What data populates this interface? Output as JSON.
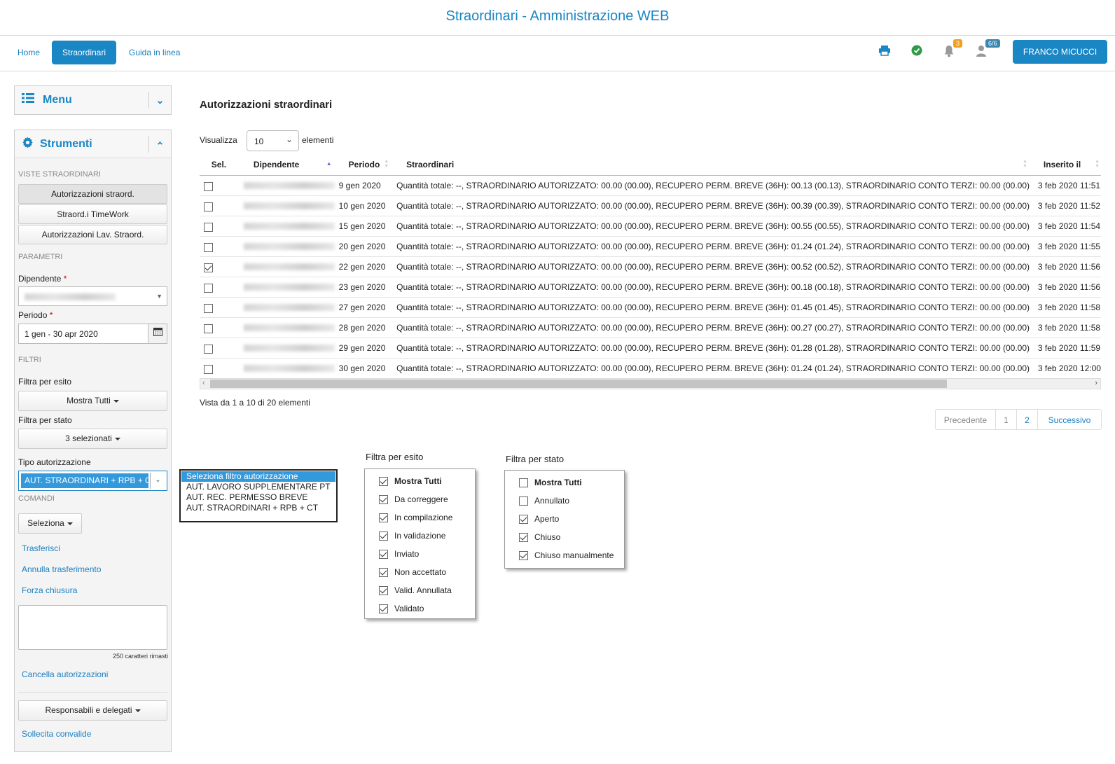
{
  "app_title": "Straordinari - Amministrazione WEB",
  "nav": {
    "home": "Home",
    "straordinari": "Straordinari",
    "guida": "Guida in linea"
  },
  "top_icons": {
    "notifications_count": "3",
    "users_count": "6/6",
    "user_name": "FRANCO MICUCCI"
  },
  "menu_panel": {
    "title": "Menu"
  },
  "tools_panel": {
    "title": "Strumenti",
    "views_title": "VISTE STRAORDINARI",
    "views": [
      "Autorizzazioni straord.",
      "Straord.i TimeWork",
      "Autorizzazioni Lav. Straord."
    ],
    "params_title": "PARAMETRI",
    "employee_label": "Dipendente",
    "required_mark": "*",
    "employee_value": "MICUCCI FRANCESCO",
    "period_label": "Periodo",
    "period_value": "1 gen - 30 apr 2020",
    "filters_title": "FILTRI",
    "esito_label": "Filtra per esito",
    "esito_value": "Mostra Tutti",
    "stato_label": "Filtra per stato",
    "stato_value": "3 selezionati",
    "tipo_label": "Tipo autorizzazione",
    "tipo_value": "AUT. STRAORDINARI + RPB + CT",
    "commands_title": "COMANDI",
    "seleziona_label": "Seleziona",
    "trasferisci": "Trasferisci",
    "annulla_trasferimento": "Annulla trasferimento",
    "forza_chiusura": "Forza chiusura",
    "chars_left": "250 caratteri rimasti",
    "cancella_autorizzazioni": "Cancella autorizzazioni",
    "responsabili_label": "Responsabili e delegati",
    "sollecita_convalide": "Sollecita convalide"
  },
  "main": {
    "title": "Autorizzazioni straordinari",
    "show_label": "Visualizza",
    "show_value": "10",
    "elements_label": "elementi",
    "columns": [
      "Sel.",
      "Dipendente",
      "Periodo",
      "Straordinari",
      "Inserito il"
    ],
    "rows": [
      {
        "checked": false,
        "employee": "MICUCCI FRANCESCO",
        "period": "9 gen 2020",
        "detail": "Quantità totale: --, STRAORDINARIO AUTORIZZATO: 00.00 (00.00), RECUPERO PERM. BREVE (36H): 00.13 (00.13), STRAORDINARIO CONTO TERZI: 00.00 (00.00)",
        "inserted": "3 feb 2020 11:51"
      },
      {
        "checked": false,
        "employee": "MICUCCI FRANCESCO",
        "period": "10 gen 2020",
        "detail": "Quantità totale: --, STRAORDINARIO AUTORIZZATO: 00.00 (00.00), RECUPERO PERM. BREVE (36H): 00.39 (00.39), STRAORDINARIO CONTO TERZI: 00.00 (00.00)",
        "inserted": "3 feb 2020 11:52"
      },
      {
        "checked": false,
        "employee": "MICUCCI FRANCESCO",
        "period": "15 gen 2020",
        "detail": "Quantità totale: --, STRAORDINARIO AUTORIZZATO: 00.00 (00.00), RECUPERO PERM. BREVE (36H): 00.55 (00.55), STRAORDINARIO CONTO TERZI: 00.00 (00.00)",
        "inserted": "3 feb 2020 11:54"
      },
      {
        "checked": false,
        "employee": "MICUCCI FRANCESCO",
        "period": "20 gen 2020",
        "detail": "Quantità totale: --, STRAORDINARIO AUTORIZZATO: 00.00 (00.00), RECUPERO PERM. BREVE (36H): 01.24 (01.24), STRAORDINARIO CONTO TERZI: 00.00 (00.00)",
        "inserted": "3 feb 2020 11:55"
      },
      {
        "checked": true,
        "employee": "MICUCCI FRANCESCO",
        "period": "22 gen 2020",
        "detail": "Quantità totale: --, STRAORDINARIO AUTORIZZATO: 00.00 (00.00), RECUPERO PERM. BREVE (36H): 00.52 (00.52), STRAORDINARIO CONTO TERZI: 00.00 (00.00)",
        "inserted": "3 feb 2020 11:56"
      },
      {
        "checked": false,
        "employee": "MICUCCI FRANCESCO",
        "period": "23 gen 2020",
        "detail": "Quantità totale: --, STRAORDINARIO AUTORIZZATO: 00.00 (00.00), RECUPERO PERM. BREVE (36H): 00.18 (00.18), STRAORDINARIO CONTO TERZI: 00.00 (00.00)",
        "inserted": "3 feb 2020 11:56"
      },
      {
        "checked": false,
        "employee": "MICUCCI FRANCESCO",
        "period": "27 gen 2020",
        "detail": "Quantità totale: --, STRAORDINARIO AUTORIZZATO: 00.00 (00.00), RECUPERO PERM. BREVE (36H): 01.45 (01.45), STRAORDINARIO CONTO TERZI: 00.00 (00.00)",
        "inserted": "3 feb 2020 11:58"
      },
      {
        "checked": false,
        "employee": "MICUCCI FRANCESCO",
        "period": "28 gen 2020",
        "detail": "Quantità totale: --, STRAORDINARIO AUTORIZZATO: 00.00 (00.00), RECUPERO PERM. BREVE (36H): 00.27 (00.27), STRAORDINARIO CONTO TERZI: 00.00 (00.00)",
        "inserted": "3 feb 2020 11:58"
      },
      {
        "checked": false,
        "employee": "MICUCCI FRANCESCO",
        "period": "29 gen 2020",
        "detail": "Quantità totale: --, STRAORDINARIO AUTORIZZATO: 00.00 (00.00), RECUPERO PERM. BREVE (36H): 01.28 (01.28), STRAORDINARIO CONTO TERZI: 00.00 (00.00)",
        "inserted": "3 feb 2020 11:59"
      },
      {
        "checked": false,
        "employee": "MICUCCI FRANCESCO",
        "period": "30 gen 2020",
        "detail": "Quantità totale: --, STRAORDINARIO AUTORIZZATO: 00.00 (00.00), RECUPERO PERM. BREVE (36H): 01.24 (01.24), STRAORDINARIO CONTO TERZI: 00.00 (00.00)",
        "inserted": "3 feb 2020 12:00"
      }
    ],
    "info": "Vista da 1 a 10 di 20 elementi",
    "pager": {
      "prev": "Precedente",
      "pages": [
        "1",
        "2"
      ],
      "next": "Successivo"
    }
  },
  "tipo_dropdown": {
    "options": [
      "Seleziona filtro autorizzazione",
      "AUT. LAVORO SUPPLEMENTARE PT",
      "AUT. REC. PERMESSO BREVE",
      "AUT. STRAORDINARI + RPB + CT"
    ],
    "highlighted_index": 0
  },
  "esito_popup": {
    "title": "Filtra per esito",
    "items": [
      {
        "label": "Mostra Tutti",
        "checked": true,
        "bold": true
      },
      {
        "label": "Da correggere",
        "checked": true
      },
      {
        "label": "In compilazione",
        "checked": true
      },
      {
        "label": "In validazione",
        "checked": true
      },
      {
        "label": "Inviato",
        "checked": true
      },
      {
        "label": "Non accettato",
        "checked": true
      },
      {
        "label": "Valid. Annullata",
        "checked": true
      },
      {
        "label": "Validato",
        "checked": true
      }
    ]
  },
  "stato_popup": {
    "title": "Filtra per stato",
    "items": [
      {
        "label": "Mostra Tutti",
        "checked": false,
        "bold": true
      },
      {
        "label": "Annullato",
        "checked": false
      },
      {
        "label": "Aperto",
        "checked": true
      },
      {
        "label": "Chiuso",
        "checked": true
      },
      {
        "label": "Chiuso manualmente",
        "checked": true
      }
    ]
  },
  "colors": {
    "accent": "#1a86c4",
    "badge_orange": "#f0a020",
    "badge_blue": "#3c87b0",
    "check_green": "#2e9b46"
  }
}
